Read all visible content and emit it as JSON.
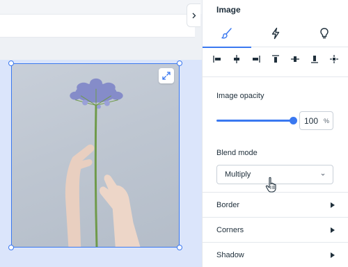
{
  "panel": {
    "title": "Image",
    "tabs": [
      {
        "icon": "brush-icon",
        "active": true
      },
      {
        "icon": "lightning-icon",
        "active": false
      },
      {
        "icon": "lightbulb-icon",
        "active": false
      }
    ],
    "align_icons": [
      "align-left-icon",
      "align-center-horizontal-icon",
      "align-right-icon",
      "align-top-icon",
      "align-middle-vertical-icon",
      "align-bottom-icon",
      "distribute-icon"
    ]
  },
  "opacity": {
    "label": "Image opacity",
    "value": "100",
    "unit": "%",
    "level": 1.0
  },
  "blend": {
    "label": "Blend mode",
    "selected": "Multiply"
  },
  "sections": [
    {
      "label": "Border"
    },
    {
      "label": "Corners"
    },
    {
      "label": "Shadow"
    }
  ],
  "colors": {
    "accent": "#3a78f0",
    "selection_bg": "#dbe5fb",
    "text": "#20303c"
  }
}
